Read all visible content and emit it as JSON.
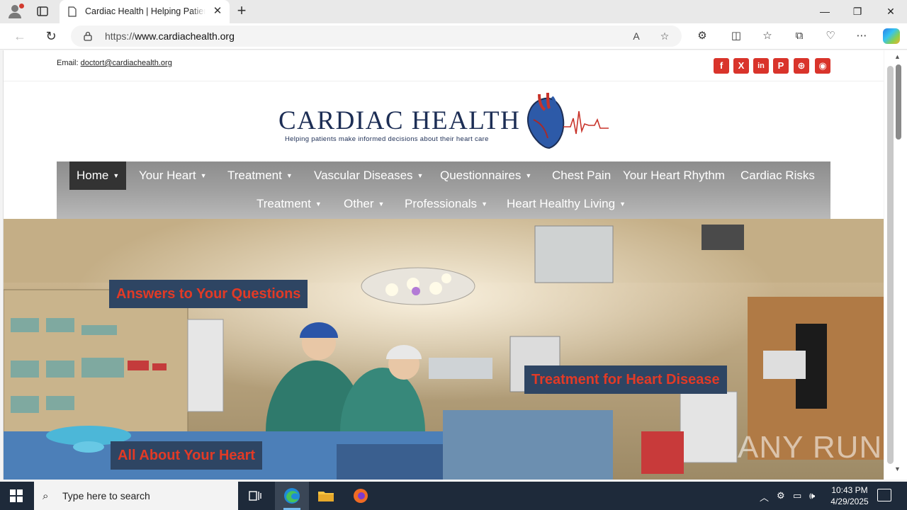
{
  "browser": {
    "tab_title": "Cardiac Health | Helping Patients Make Informed Decisions",
    "url_prefix": "https://",
    "url_host": "www.cardiachealth.org",
    "new_tab": "+",
    "close_tab": "✕"
  },
  "site": {
    "email_label": "Email:",
    "email_address": "doctort@cardiachealth.org",
    "social": [
      "facebook-icon",
      "x-icon",
      "linkedin-icon",
      "pinterest-icon",
      "dribbble-icon",
      "rss-icon"
    ],
    "logo_title": "CARDIAC HEALTH",
    "tagline": "Helping patients make informed decisions about their heart care",
    "menu_row1": [
      "Home",
      "Your Heart",
      "Treatment",
      "Vascular Diseases",
      "Questionnaires",
      "Chest Pain",
      "Your Heart Rhythm",
      "Cardiac Risks"
    ],
    "menu_row2": [
      "Treatment",
      "Other",
      "Professionals",
      "Heart Healthy Living"
    ],
    "hero_labels": [
      "Answers to Your Questions",
      "Treatment for Heart Disease",
      "All About Your Heart"
    ],
    "watermark": "ANY RUN"
  },
  "taskbar": {
    "search_placeholder": "Type here to search",
    "time": "10:43 PM",
    "date": "4/29/2025"
  },
  "colors": {
    "brand_navy": "#1d2e55",
    "social_red": "#d9342b",
    "hero_label_bg": "#2e4563",
    "hero_label_text": "#e23a26",
    "menu_active": "#333333"
  }
}
